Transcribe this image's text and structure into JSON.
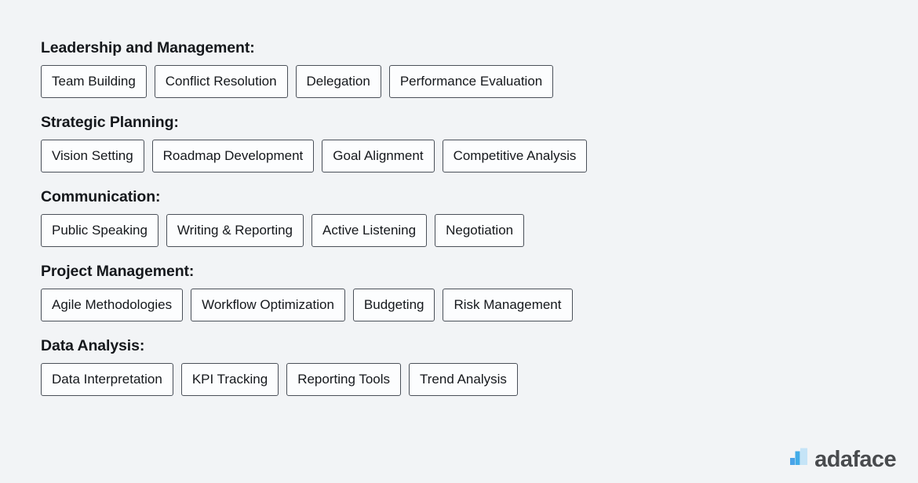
{
  "page": {
    "background_color": "#f2f4f6",
    "text_color": "#15181c"
  },
  "skill_groups": [
    {
      "heading": "Leadership and Management:",
      "tags": [
        "Team Building",
        "Conflict Resolution",
        "Delegation",
        "Performance Evaluation"
      ]
    },
    {
      "heading": "Strategic Planning:",
      "tags": [
        "Vision Setting",
        "Roadmap Development",
        "Goal Alignment",
        "Competitive Analysis"
      ]
    },
    {
      "heading": "Communication:",
      "tags": [
        "Public Speaking",
        "Writing & Reporting",
        "Active Listening",
        "Negotiation"
      ]
    },
    {
      "heading": "Project Management:",
      "tags": [
        "Agile Methodologies",
        "Workflow Optimization",
        "Budgeting",
        "Risk Management"
      ]
    },
    {
      "heading": "Data Analysis:",
      "tags": [
        "Data Interpretation",
        "KPI Tracking",
        "Reporting Tools",
        "Trend Analysis"
      ]
    }
  ],
  "brand": {
    "wordmark": "adaface",
    "mark_icon": "bar-chart-icon",
    "mark_colors": {
      "bar_left": "#4aa3e8",
      "bar_middle": "#42ace8",
      "bar_right": "#c5e4f7"
    },
    "wordmark_color": "#494b4e"
  }
}
